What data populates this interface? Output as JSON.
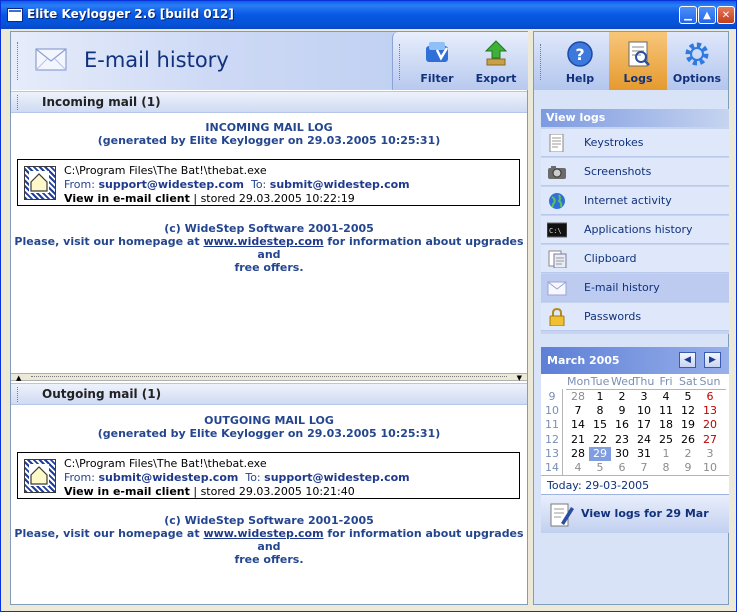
{
  "window": {
    "title": "Elite Keylogger 2.6 [build 012]",
    "controls": [
      "minimize",
      "maximize",
      "close"
    ]
  },
  "header": {
    "title": "E-mail history",
    "icon": "envelope-icon",
    "tools": [
      {
        "label": "Filter",
        "icon": "filter-icon"
      },
      {
        "label": "Export",
        "icon": "export-icon"
      }
    ]
  },
  "incoming": {
    "section_title": "Incoming mail (1)",
    "log_title": "INCOMING MAIL LOG",
    "generated": "(generated by Elite Keylogger on 29.03.2005 10:25:31)",
    "entry": {
      "path": "C:\\Program Files\\The Bat!\\thebat.exe",
      "from_label": "From:",
      "from": "support@widestep.com",
      "to_label": "To:",
      "to": "submit@widestep.com",
      "view_label": "View in e-mail client",
      "stored": "| stored 29.03.2005 10:22:19"
    },
    "copyright": "(c) WideStep Software 2001-2005",
    "visit_pre": "Please, visit our homepage at",
    "homepage": "www.widestep.com",
    "visit_post": "for information about upgrades and",
    "visit_line2": "free offers."
  },
  "outgoing": {
    "section_title": "Outgoing mail (1)",
    "log_title": "OUTGOING MAIL LOG",
    "generated": "(generated by Elite Keylogger on 29.03.2005 10:25:31)",
    "entry": {
      "path": "C:\\Program Files\\The Bat!\\thebat.exe",
      "from_label": "From:",
      "from": "submit@widestep.com",
      "to_label": "To:",
      "to": "support@widestep.com",
      "view_label": "View in e-mail client",
      "stored": "| stored 29.03.2005 10:21:40"
    },
    "copyright": "(c) WideStep Software 2001-2005",
    "visit_pre": "Please, visit our homepage at",
    "homepage": "www.widestep.com",
    "visit_post": "for information about upgrades and",
    "visit_line2": "free offers."
  },
  "right_toolbar": [
    {
      "label": "Help",
      "icon": "help-icon",
      "active": false
    },
    {
      "label": "Logs",
      "icon": "logs-icon",
      "active": true
    },
    {
      "label": "Options",
      "icon": "options-gear-icon",
      "active": false
    }
  ],
  "nav": {
    "heading": "View logs",
    "items": [
      {
        "label": "Keystrokes",
        "icon": "keystrokes-document-icon"
      },
      {
        "label": "Screenshots",
        "icon": "camera-icon"
      },
      {
        "label": "Internet activity",
        "icon": "globe-icon"
      },
      {
        "label": "Applications history",
        "icon": "console-icon"
      },
      {
        "label": "Clipboard",
        "icon": "clipboard-icon"
      },
      {
        "label": "E-mail history",
        "icon": "envelope-icon"
      },
      {
        "label": "Passwords",
        "icon": "padlock-icon"
      }
    ],
    "selected": "E-mail history"
  },
  "calendar": {
    "month": "March 2005",
    "weekdays": [
      "Mon",
      "Tue",
      "Wed",
      "Thu",
      "Fri",
      "Sat",
      "Sun"
    ],
    "weeks": [
      {
        "num": "9",
        "days": [
          "28",
          "1",
          "2",
          "3",
          "4",
          "5",
          "6"
        ]
      },
      {
        "num": "10",
        "days": [
          "7",
          "8",
          "9",
          "10",
          "11",
          "12",
          "13"
        ]
      },
      {
        "num": "11",
        "days": [
          "14",
          "15",
          "16",
          "17",
          "18",
          "19",
          "20"
        ]
      },
      {
        "num": "12",
        "days": [
          "21",
          "22",
          "23",
          "24",
          "25",
          "26",
          "27"
        ]
      },
      {
        "num": "13",
        "days": [
          "28",
          "29",
          "30",
          "31",
          "1",
          "2",
          "3"
        ]
      },
      {
        "num": "14",
        "days": [
          "4",
          "5",
          "6",
          "7",
          "8",
          "9",
          "10"
        ]
      }
    ],
    "today_text": "Today: 29-03-2005",
    "selected_day": "29"
  },
  "view_button": {
    "label": "View logs for 29 Mar",
    "icon": "view-logs-pen-icon"
  },
  "colors": {
    "accent": "#10317c",
    "link": "#1f3a8c",
    "highlight": "#e59a2f",
    "sunday": "#c00000"
  }
}
